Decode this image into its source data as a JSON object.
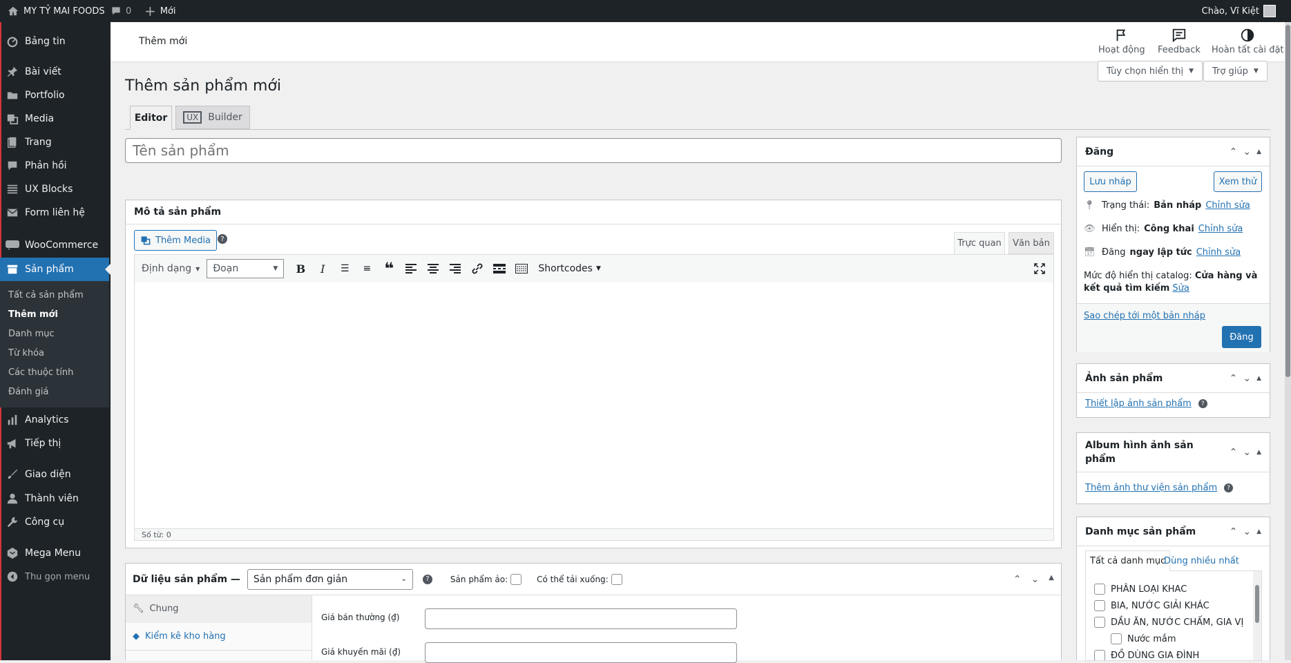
{
  "adminbar": {
    "site": "MY TỶ MAI FOODS",
    "comments": "0",
    "new": "Mới",
    "greeting": "Chào, Vĩ Kiệt"
  },
  "sidebar": {
    "items": [
      {
        "label": "Bảng tin",
        "icon": "dashboard-icon"
      },
      {
        "label": "Bài viết",
        "icon": "pin-icon"
      },
      {
        "label": "Portfolio",
        "icon": "folder-icon"
      },
      {
        "label": "Media",
        "icon": "media-icon"
      },
      {
        "label": "Trang",
        "icon": "page-icon"
      },
      {
        "label": "Phản hồi",
        "icon": "comment-icon"
      },
      {
        "label": "UX Blocks",
        "icon": "blocks-icon"
      },
      {
        "label": "Form liên hệ",
        "icon": "mail-icon"
      },
      {
        "label": "WooCommerce",
        "icon": "woo-icon"
      },
      {
        "label": "Sản phẩm",
        "icon": "archive-icon"
      },
      {
        "label": "Analytics",
        "icon": "bar-chart-icon"
      },
      {
        "label": "Tiếp thị",
        "icon": "megaphone-icon"
      },
      {
        "label": "Giao diện",
        "icon": "brush-icon"
      },
      {
        "label": "Thành viên",
        "icon": "user-icon"
      },
      {
        "label": "Công cụ",
        "icon": "wrench-icon"
      },
      {
        "label": "Mega Menu",
        "icon": "mega-menu-icon"
      },
      {
        "label": "Thu gọn menu",
        "icon": "collapse-icon"
      }
    ],
    "submenu": [
      "Tất cả sản phẩm",
      "Thêm mới",
      "Danh mục",
      "Từ khóa",
      "Các thuộc tính",
      "Đánh giá"
    ]
  },
  "topbar": {
    "title": "Thêm mới",
    "activity": "Hoạt động",
    "feedback": "Feedback",
    "finish": "Hoàn tất cài đặt"
  },
  "screen_options": "Tùy chọn hiển thị",
  "help": "Trợ giúp",
  "page_title": "Thêm sản phẩm mới",
  "editor_tabs": {
    "editor": "Editor",
    "ux": "UX",
    "builder": "Builder"
  },
  "title_placeholder": "Tên sản phẩm",
  "description": {
    "header": "Mô tả sản phẩm",
    "add_media": "Thêm Media",
    "visual": "Trực quan",
    "text": "Văn bản",
    "format": "Định dạng",
    "paragraph": "Đoạn",
    "shortcodes": "Shortcodes",
    "word_count": "Số từ: 0"
  },
  "product_data": {
    "label": "Dữ liệu sản phẩm —",
    "type": "Sản phẩm đơn giản",
    "virtual": "Sản phẩm ảo:",
    "downloadable": "Có thể tải xuống:",
    "tabs": [
      "Chung",
      "Kiểm kê kho hàng"
    ],
    "regular_price": "Giá bán thường (₫)",
    "sale_price": "Giá khuyến mãi (₫)"
  },
  "publish": {
    "title": "Đăng",
    "save_draft": "Lưu nháp",
    "preview": "Xem thử",
    "status_label": "Trạng thái:",
    "status_value": "Bản nháp",
    "visibility_label": "Hiển thị:",
    "visibility_value": "Công khai",
    "publish_label": "Đăng",
    "publish_value": "ngay lập tức",
    "edit": "Chỉnh sửa",
    "catalog_label": "Mức độ hiển thị catalog:",
    "catalog_value": "Cửa hàng và kết quả tìm kiếm",
    "catalog_edit": "Sửa",
    "copy_draft": "Sao chép tới một bản nháp",
    "publish_btn": "Đăng"
  },
  "product_image": {
    "title": "Ảnh sản phẩm",
    "link": "Thiết lập ảnh sản phẩm"
  },
  "gallery": {
    "title": "Album hình ảnh sản phẩm",
    "link": "Thêm ảnh thư viện sản phẩm"
  },
  "categories": {
    "title": "Danh mục sản phẩm",
    "tab_all": "Tất cả danh mục",
    "tab_popular": "Dùng nhiều nhất",
    "items": [
      "PHÂN LOẠI KHAC",
      "BIA, NƯỚC GIẢI KHÁC",
      "DẦU ĂN, NƯỚC CHẤM, GIA VỊ",
      "Nước mắm",
      "ĐỒ DÙNG GIA ĐÌNH"
    ]
  }
}
